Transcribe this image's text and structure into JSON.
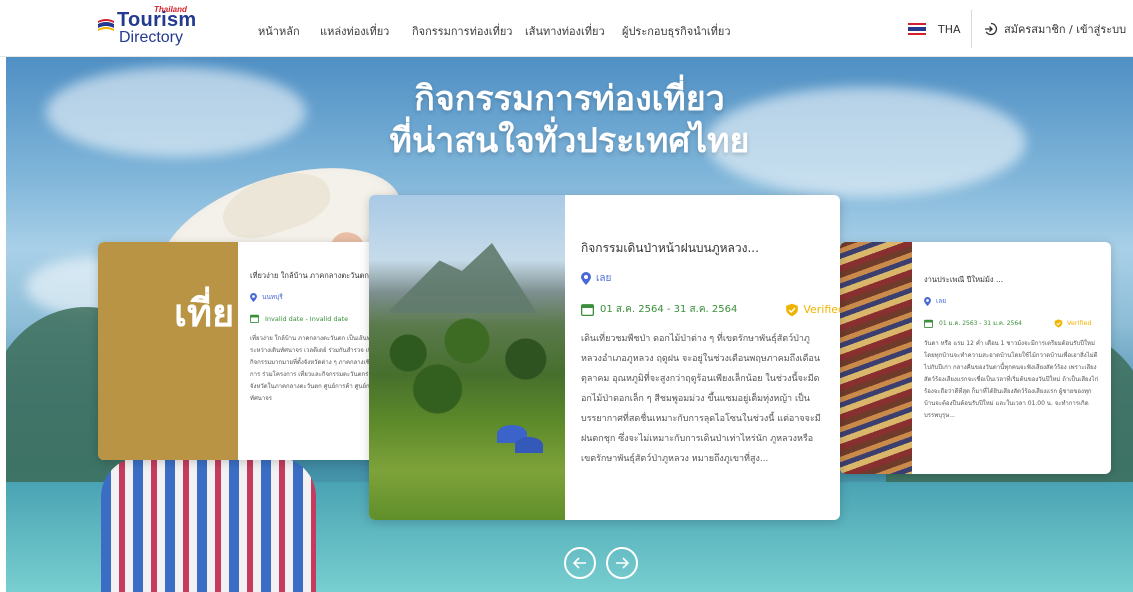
{
  "header": {
    "logo": {
      "tag": "Thailand",
      "line1": "Tourism",
      "line2": "Directory"
    },
    "nav": [
      {
        "label": "หน้าหลัก"
      },
      {
        "label": "แหล่งท่องเที่ยว"
      },
      {
        "label": "กิจกรรมการท่องเที่ยว"
      },
      {
        "label": "เส้นทางท่องเที่ยว"
      },
      {
        "label": "ผู้ประกอบธุรกิจนำเที่ยว"
      }
    ],
    "language": "THA",
    "login": "สมัครสมาชิก / เข้าสู่ระบบ"
  },
  "hero": {
    "title_line1": "กิจกรรมการท่องเที่ยว",
    "title_line2": "ที่น่าสนใจทั่วประเทศไทย"
  },
  "cards": {
    "left": {
      "overlay": "เที่ย",
      "title": "เที่ยวง่าย ใกล้บ้าน ภาคกลางตะวันตก",
      "location": "นนทบุรี",
      "date": "Invalid date - Invalid date",
      "description": "เที่ยวง่าย ใกล้บ้าน ภาคกลางตะวันตก เป็นเส้นทางท่องเที่ยวระหว่างเดินทัศนาจร เวลดีเดย์ ร่วมกันสำรวจ เที่ยวและกิจกรรมมากมายที่ตั้งจังหวัดต่าง ๆ ภาคกลางเชิญผู้ประกอบการ ร่วมโครงการ เที่ยวและกิจกรรมตะวันตกร่วมกัน ในจังหวัดในภาคกลางตะวันตก ศูนย์การค้า ศูนย์การค้าเชิงทัศนาจร"
    },
    "center": {
      "title": "กิจกรรมเดินป่าหน้าฝนบนภูหลวง...",
      "location": "เลย",
      "date": "01 ส.ค. 2564 - 31 ส.ค. 2564",
      "verified": "Verified",
      "description": "เดินเที่ยวชมพืชป่า ดอกไม้ป่าต่าง ๆ ที่เขตรักษาพันธุ์สัตว์ป่าภูหลวงอำเภอภูหลวง ฤดูฝน จะอยู่ในช่วงเดือนพฤษภาคมถึงเดือนตุลาคม อุณหภูมิที่จะสูงกว่าฤดูร้อนเพียงเล็กน้อย ในช่วงนี้จะมีดอกไม้ป่าดอกเล็ก ๆ สีชมพูอมม่วง ขึ้นแซมอยู่เต็มทุ่งหญ้า เป็นบรรยากาศที่สดชื่นเหมาะกับการลุดไอโซนในช่วงนี้ แต่อาจจะมีฝนตกชุก ซึ่งจะไม่เหมาะกับการเดินป่าเท่าไหร่นัก ภูหลวงหรือเขตรักษาพันธุ์สัตว์ป่าภูหลวง หมายถึงภูเขาที่สูง..."
    },
    "right": {
      "title": "งานประเพณี ปีใหม่ม้ง ...",
      "location": "เลย",
      "date": "01 ม.ค. 2563 - 31 ม.ค. 2564",
      "verified": "Verified",
      "description": "วันดา หรือ แรม 12 ค่ำ เดือน 1 ชาวม้งจะมีการเตรียมต้อนรับปีใหม่โดยทุกบ้านจะทำความสะอาดบ้านโดยใช้ไม้กวาดบ้านเพื่อเอาสิ่งไม่ดีไปกับปีเก่า กลางคืนของวันดานี้ทุกคนจะฟังเสียงสัตว์ร้อง เพราะเสียงสัตว์ร้องเสียงแรกจะเชื่อเป็นเวลาที่เริ่มต้นของวันปีใหม่ ถ้าเป็นเสียงไก่ร้องจะถือว่าดีที่สุด ก็มาที่ได้ยินเสียงสัตว์ร้องเสียงแรก ผู้ชายของทุกบ้านจะต้องปีนต้อนรับปีใหม่ และในเวลา 01.00 น. จะทำการเกิดบรรพบุรุษ..."
    }
  },
  "colors": {
    "brand": "#233a8f",
    "location": "#4a6bd6",
    "date": "#3a8f3a",
    "verified": "#f0b400"
  }
}
